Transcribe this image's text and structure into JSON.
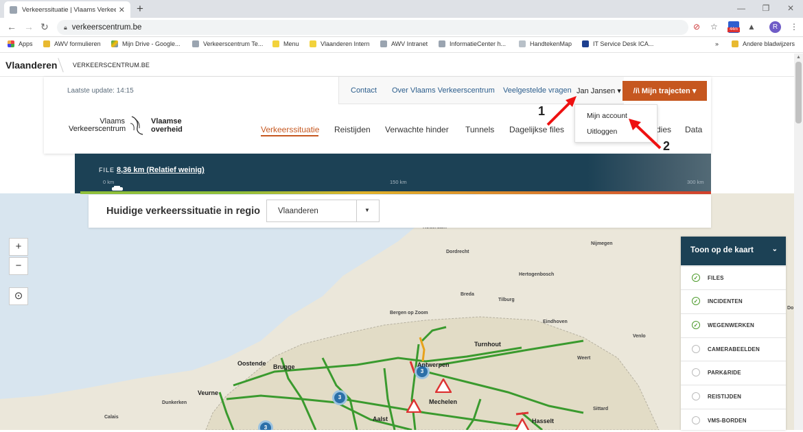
{
  "browser": {
    "tab_title": "Verkeerssituatie | Vlaams Verkeer",
    "url": "verkeerscentrum.be",
    "extension_badge": "44m",
    "profile_initial": "R",
    "bookmarks": [
      "Apps",
      "AWV formulieren",
      "Mijn Drive - Google...",
      "Verkeerscentrum Te...",
      "Menu",
      "Vlaanderen Intern",
      "AWV Intranet",
      "InformatieCenter h...",
      "HandtekenMap",
      "IT Service Desk ICA..."
    ],
    "bookmarks_overflow": "»",
    "other_bookmarks": "Andere bladwijzers"
  },
  "site": {
    "flanders": "Vlaanderen",
    "domain_label": "VERKEERSCENTRUM.BE",
    "last_update": "Laatste update: 14:15",
    "top_nav": [
      "Contact",
      "Over Vlaams Verkeerscentrum",
      "Veelgestelde vragen"
    ],
    "user_name": "Jan Jansen ▾",
    "trajects_button": "/i\\  Mijn trajecten ▾",
    "logo_left_line1": "Vlaams",
    "logo_left_line2": "Verkeerscentrum",
    "logo_right_line1": "Vlaamse",
    "logo_right_line2": "overheid",
    "main_nav": [
      "Verkeerssituatie",
      "Reistijden",
      "Verwachte hinder",
      "Tunnels",
      "Dagelijkse files",
      "dies",
      "Data"
    ],
    "account_menu": [
      "Mijn account",
      "Uitloggen"
    ],
    "annotation_1": "1",
    "annotation_2": "2"
  },
  "file_bar": {
    "label": "FILE",
    "value": "8,36 km (Relatief weinig)",
    "scale": [
      "0 km",
      "150 km",
      "300 km"
    ]
  },
  "region": {
    "label": "Huidige verkeerssituatie in regio",
    "selected": "Vlaanderen"
  },
  "map": {
    "zoom_in": "+",
    "zoom_out": "−",
    "locate": "⊙",
    "cities": [
      "Rotterdam",
      "Dordrecht",
      "Nijmegen",
      "Hertogenbosch",
      "Breda",
      "Tilburg",
      "Bergen op Zoom",
      "Eindhoven",
      "Venlo",
      "Turnhout",
      "Oostende",
      "Brugge",
      "Antwerpen",
      "Weert",
      "Veurne",
      "Mechelen",
      "Dunkerken",
      "Aalst",
      "Hasselt",
      "Sittard",
      "Calais",
      "Do"
    ],
    "cluster_counts": [
      "3",
      "3",
      "3"
    ]
  },
  "layers_panel": {
    "title": "Toon op de kaart",
    "items": [
      {
        "label": "FILES",
        "checked": true
      },
      {
        "label": "INCIDENTEN",
        "checked": true
      },
      {
        "label": "WEGENWERKEN",
        "checked": true
      },
      {
        "label": "CAMERABEELDEN",
        "checked": false
      },
      {
        "label": "PARK&RIDE",
        "checked": false
      },
      {
        "label": "REISTIJDEN",
        "checked": false
      },
      {
        "label": "VMS-BORDEN",
        "checked": false
      }
    ]
  },
  "colors": {
    "accent": "#c6571f",
    "navy": "#1c4155",
    "road": "#3a9a2e",
    "water": "#d8e5ef",
    "land": "#e9e5d8"
  }
}
